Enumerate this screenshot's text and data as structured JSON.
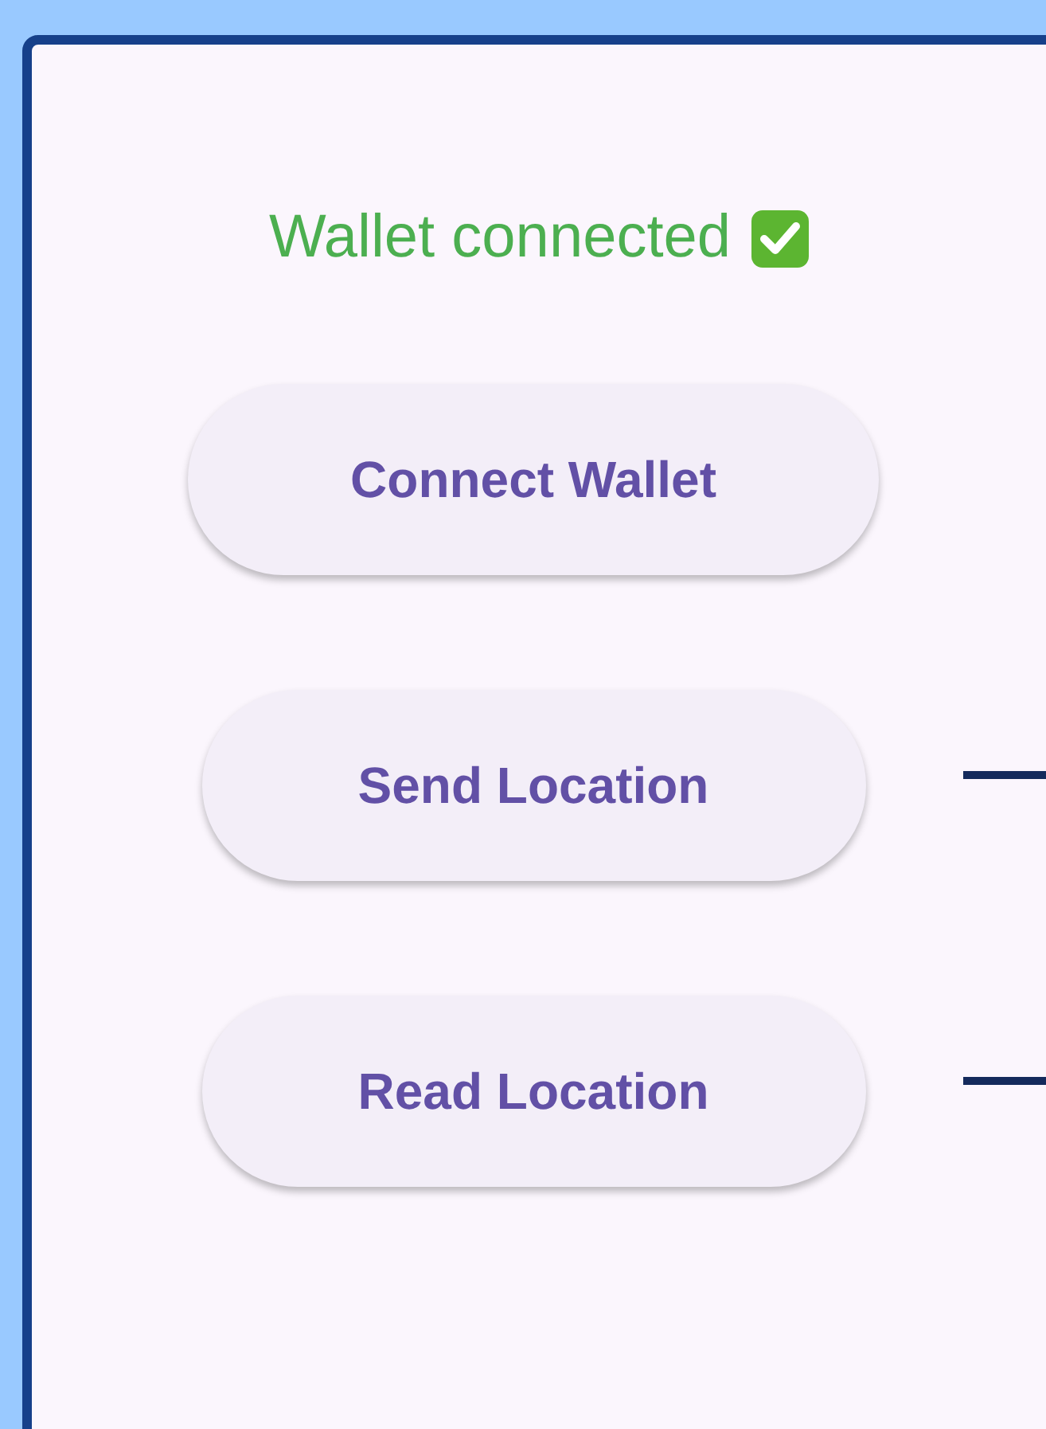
{
  "status": {
    "text": "Wallet connected",
    "connected": true
  },
  "buttons": [
    {
      "label": "Connect Wallet",
      "connector": false
    },
    {
      "label": "Send Location",
      "connector": true
    },
    {
      "label": "Read Location",
      "connector": true
    }
  ]
}
